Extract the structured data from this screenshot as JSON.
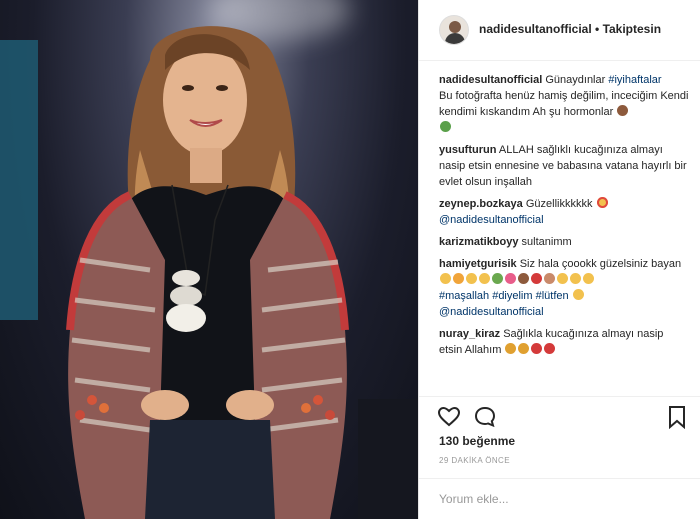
{
  "post": {
    "username": "nadidesultanofficial",
    "separator": " • ",
    "follow_status": "Takiptesin"
  },
  "comments": [
    {
      "user": "nadidesultanofficial",
      "text_a": "Günaydınlar",
      "tag": "#iyihaftalar",
      "text_b": "Bu fotoğrafta henüz hamiş değilim, inceciğim Kendi kendimi kıskandım Ah şu hormonlar"
    },
    {
      "user": "yusufturun",
      "text": "ALLAH sağlıklı kucağınıza almayı nasip etsin ennesine ve babasına vatana hayırlı bir evlet olsun inşallah"
    },
    {
      "user": "zeynep.bozkaya",
      "text": "Güzellikkkkkk",
      "mention": "@nadidesultanofficial"
    },
    {
      "user": "karizmatikboyy",
      "text": "sultanimm"
    },
    {
      "user": "hamiyetgurisik",
      "text": "Siz hala çoookk güzelsiniz bayan",
      "tags": "#maşallah #diyelim #lütfen",
      "mention": "@nadidesultanofficial"
    },
    {
      "user": "nuray_kiraz",
      "text": "Sağlıkla kucağınıza almayı nasip etsin Allahım"
    }
  ],
  "likes_text": "130 beğenme",
  "timestamp": "29 DAKİKA ÖNCE",
  "comment_placeholder": "Yorum ekle...",
  "icons": {
    "like": "heart-outline-icon",
    "comment": "speech-bubble-icon",
    "save": "bookmark-icon"
  },
  "colors": {
    "text": "#262626",
    "link": "#003569",
    "muted": "#999999"
  }
}
